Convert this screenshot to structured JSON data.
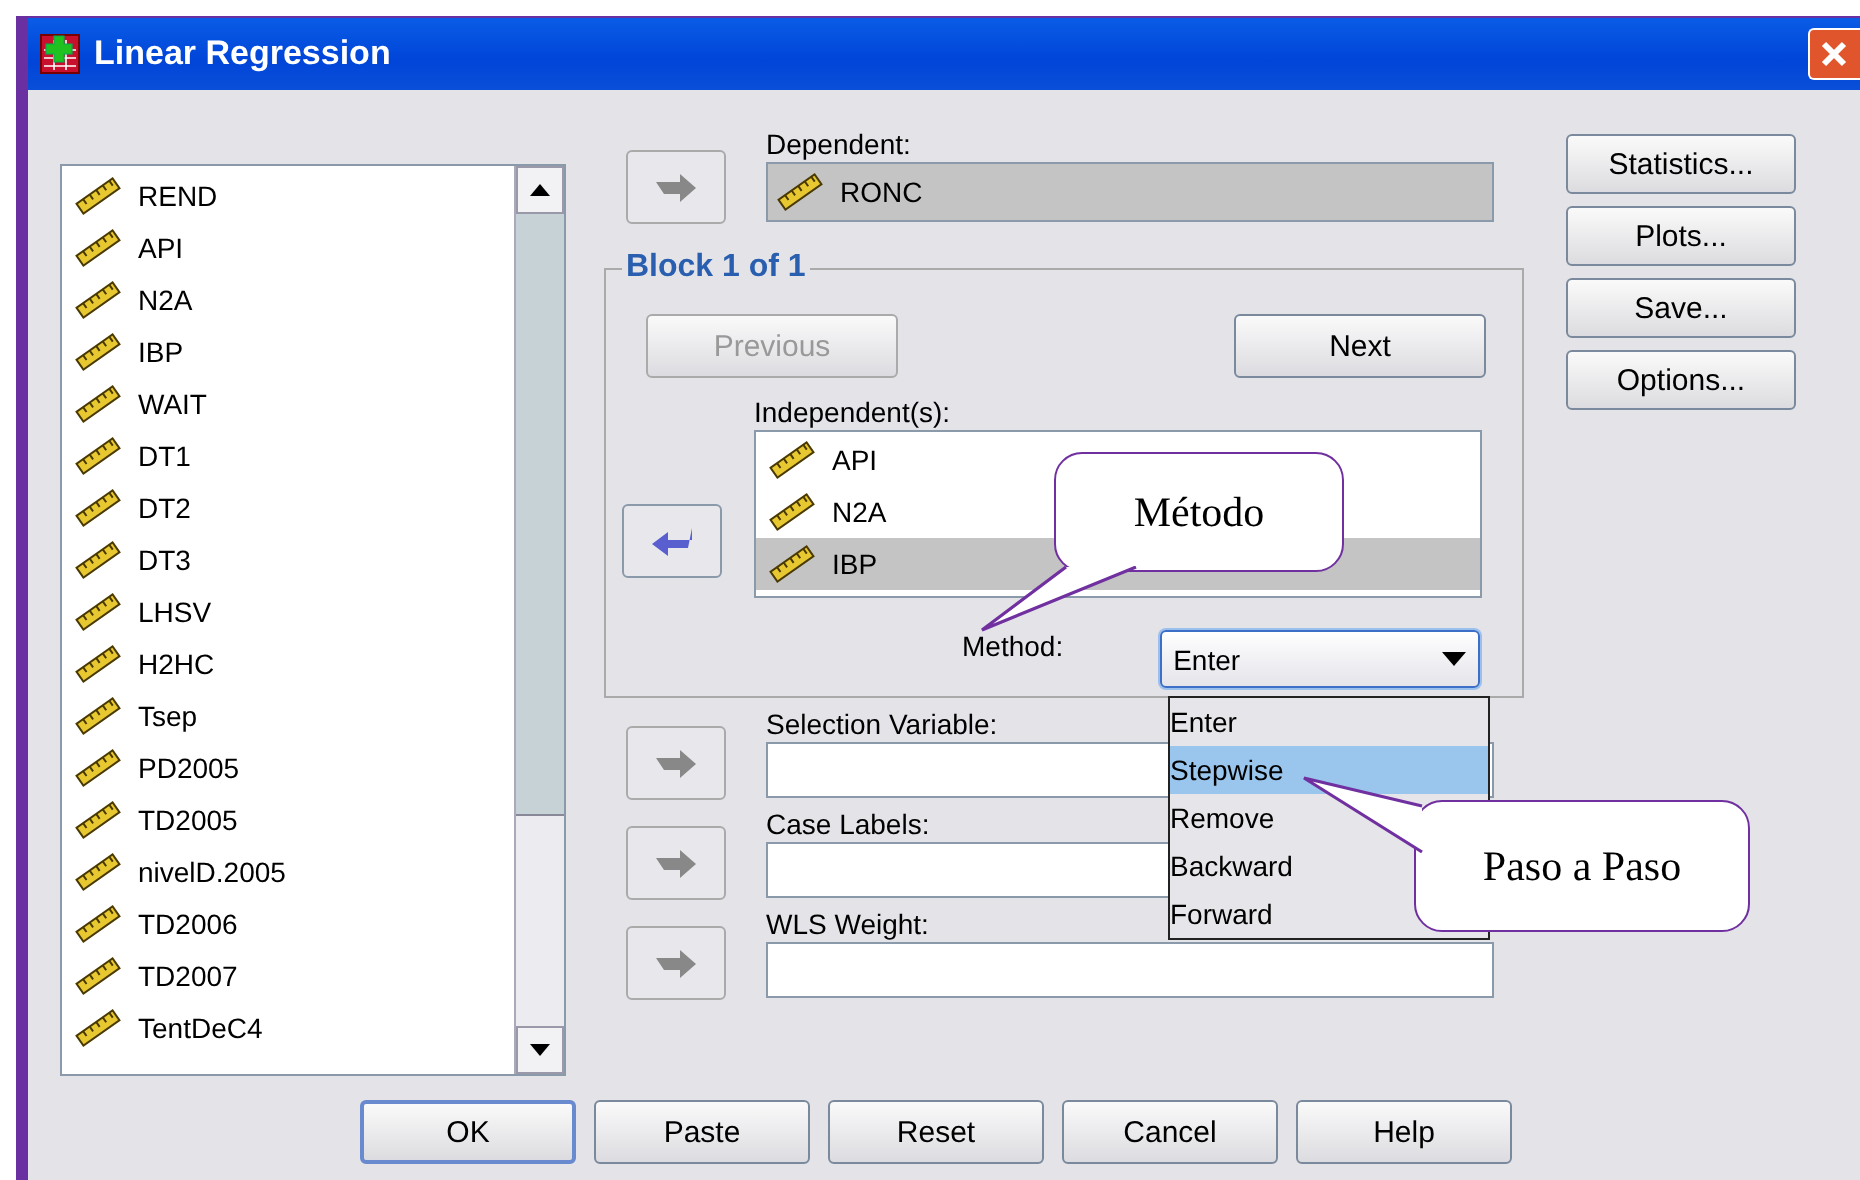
{
  "window": {
    "title": "Linear Regression"
  },
  "variables": [
    "REND",
    "API",
    "N2A",
    "IBP",
    "WAIT",
    "DT1",
    "DT2",
    "DT3",
    "LHSV",
    "H2HC",
    "Tsep",
    "PD2005",
    "TD2005",
    "nivelD.2005",
    "TD2006",
    "TD2007",
    "TentDeC4"
  ],
  "dependent": {
    "label": "Dependent:",
    "value": "RONC"
  },
  "block": {
    "title": "Block 1 of 1",
    "buttons": [
      {
        "label": "Previous",
        "disabled": true
      },
      {
        "label": "Next",
        "disabled": false
      }
    ]
  },
  "independents": {
    "label": "Independent(s):",
    "items": [
      {
        "name": "API",
        "selected": false
      },
      {
        "name": "N2A",
        "selected": false
      },
      {
        "name": "IBP",
        "selected": true
      }
    ]
  },
  "method": {
    "label": "Method:",
    "value": "Enter",
    "expanded": true,
    "options": [
      {
        "label": "Enter",
        "highlighted": false
      },
      {
        "label": "Stepwise",
        "highlighted": true
      },
      {
        "label": "Remove",
        "highlighted": false
      },
      {
        "label": "Backward",
        "highlighted": false
      },
      {
        "label": "Forward",
        "highlighted": false
      }
    ]
  },
  "fields": [
    {
      "label": "Selection Variable:"
    },
    {
      "label": "Case Labels:"
    },
    {
      "label": "WLS Weight:"
    }
  ],
  "side_buttons": [
    "Statistics...",
    "Plots...",
    "Save...",
    "Options..."
  ],
  "bottom_buttons": [
    "OK",
    "Paste",
    "Reset",
    "Cancel",
    "Help"
  ],
  "callouts": [
    {
      "text": "Método"
    },
    {
      "text": "Paso a Paso"
    }
  ]
}
